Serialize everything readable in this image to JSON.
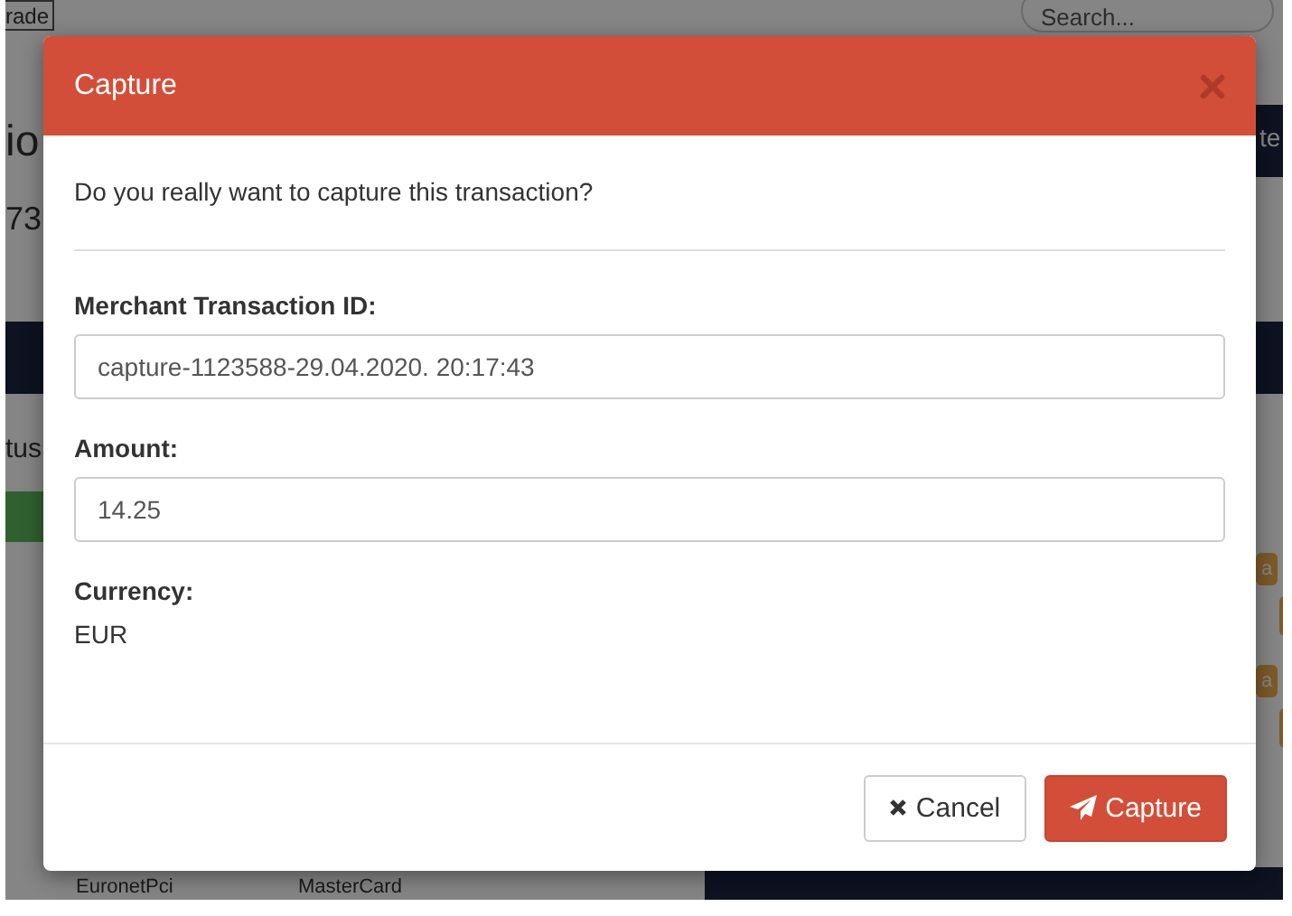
{
  "background": {
    "tab": "rade",
    "search": {
      "placeholder": "Search..."
    },
    "heading_fragments": [
      "io",
      "73"
    ],
    "label_fragment": "tus",
    "header_fragment": "te",
    "badges": [
      "a",
      "a"
    ],
    "row": [
      "EuronetPci",
      "MasterCard"
    ]
  },
  "dialog": {
    "title": "Capture",
    "message": "Do you really want to capture this transaction?",
    "fields": [
      {
        "label": "Merchant Transaction ID:",
        "value": "capture-1123588-29.04.2020. 20:17:43"
      },
      {
        "label": "Amount:",
        "value": "14.25"
      }
    ],
    "currency": {
      "label": "Currency:",
      "value": "EUR"
    },
    "buttons": [
      {
        "label": "Cancel",
        "kind": "cancel"
      },
      {
        "label": "Capture",
        "kind": "primary"
      }
    ]
  }
}
